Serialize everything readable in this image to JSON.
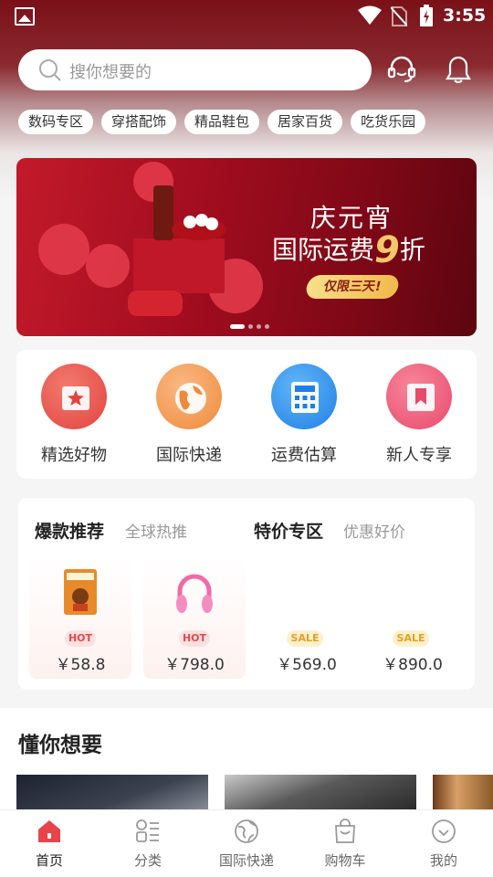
{
  "status_bar": {
    "time": "3:55"
  },
  "search": {
    "placeholder": "搜你想要的"
  },
  "tags": [
    "数码专区",
    "穿搭配饰",
    "精品鞋包",
    "居家百货",
    "吃货乐园"
  ],
  "banner": {
    "line1": "庆元宵",
    "line2_prefix": "国际运费",
    "discount": "9",
    "line2_suffix": "折",
    "pill": "仅限三天!",
    "dots": 4,
    "active_dot": 0
  },
  "services": [
    {
      "label": "精选好物",
      "icon": "star-card-icon",
      "color": "#e9524f"
    },
    {
      "label": "国际快递",
      "icon": "globe-icon",
      "color": "#f59a4f"
    },
    {
      "label": "运费估算",
      "icon": "calculator-icon",
      "color": "#2f8ff0"
    },
    {
      "label": "新人专享",
      "icon": "bookmark-icon",
      "color": "#ee5a77"
    }
  ],
  "hot_section": {
    "title": "爆款推荐",
    "subtitle": "全球热推",
    "products": [
      {
        "badge": "HOT",
        "price": "￥58.8"
      },
      {
        "badge": "HOT",
        "price": "￥798.0"
      }
    ]
  },
  "sale_section": {
    "title": "特价专区",
    "subtitle": "优惠好价",
    "products": [
      {
        "badge": "SALE",
        "price": "￥569.0"
      },
      {
        "badge": "SALE",
        "price": "￥890.0"
      }
    ]
  },
  "recommend": {
    "title": "懂你想要"
  },
  "bottom_nav": [
    {
      "label": "首页",
      "icon": "home-icon",
      "active": true
    },
    {
      "label": "分类",
      "icon": "category-icon",
      "active": false
    },
    {
      "label": "国际快递",
      "icon": "globe-icon",
      "active": false
    },
    {
      "label": "购物车",
      "icon": "bag-icon",
      "active": false
    },
    {
      "label": "我的",
      "icon": "profile-icon",
      "active": false
    }
  ],
  "colors": {
    "accent": "#e9434a",
    "header_top": "#7a1018"
  }
}
